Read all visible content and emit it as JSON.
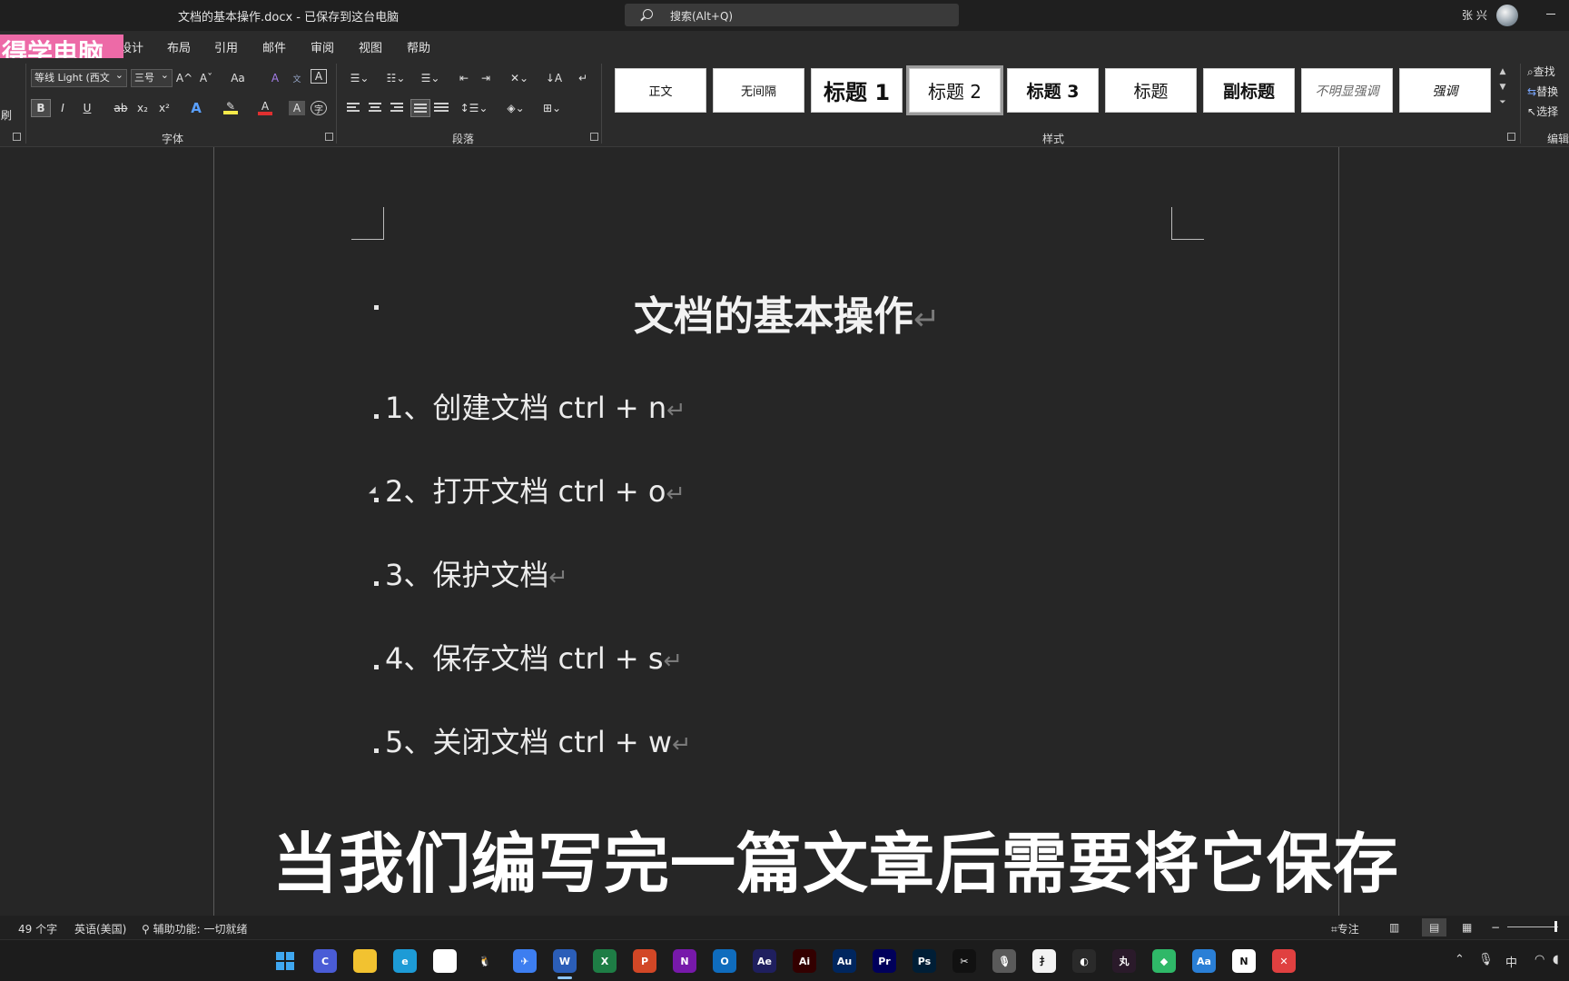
{
  "window": {
    "title": "文档的基本操作.docx  -  已保存到这台电脑",
    "search_placeholder": "搜索(Alt+Q)",
    "user": "张 兴"
  },
  "watermark": "得学电脑",
  "menu": {
    "tabs": [
      "设计",
      "布局",
      "引用",
      "邮件",
      "审阅",
      "视图",
      "帮助"
    ]
  },
  "ribbon": {
    "clipboard_partial": "刷",
    "font": {
      "name": "等线 Light (西文",
      "size": "三号",
      "label": "字体",
      "bold": "B",
      "italic": "I",
      "underline": "U",
      "strike": "ab",
      "subscript": "x₂",
      "superscript": "x²",
      "grow": "A^",
      "shrink": "Aˇ",
      "case": "Aa",
      "highlight_color": "#f5e94a",
      "font_color": "#e03030"
    },
    "paragraph": {
      "label": "段落"
    },
    "styles": {
      "label": "样式",
      "items": [
        "正文",
        "无间隔",
        "标题 1",
        "标题 2",
        "标题 3",
        "标题",
        "副标题",
        "不明显强调",
        "强调"
      ]
    },
    "editing": {
      "label": "编辑",
      "find": "查找",
      "replace": "替换",
      "select": "选择"
    }
  },
  "document": {
    "heading": "文档的基本操作",
    "items": [
      "1、创建文档  ctrl + n",
      "2、打开文档  ctrl + o",
      "3、保护文档",
      "4、保存文档  ctrl + s",
      "5、关闭文档  ctrl + w"
    ],
    "paragraph_mark": "↵"
  },
  "caption": "当我们编写完一篇文章后需要将它保存",
  "statusbar": {
    "word_count": "49 个字",
    "language": "英语(美国)",
    "accessibility": "辅助功能: 一切就绪",
    "focus": "专注"
  },
  "taskbar": {
    "icons": [
      {
        "name": "windows-start-icon",
        "color": "#3fa7f0",
        "text": ""
      },
      {
        "name": "browser-c-icon",
        "color": "#4a5cd6",
        "text": "C"
      },
      {
        "name": "file-explorer-icon",
        "color": "#f2c230",
        "text": ""
      },
      {
        "name": "edge-icon",
        "color": "#1d9bd6",
        "text": "e"
      },
      {
        "name": "photos-icon",
        "color": "#ffffff",
        "text": ""
      },
      {
        "name": "qq-icon",
        "color": "#1c1c1c",
        "text": "🐧"
      },
      {
        "name": "feishu-icon",
        "color": "#3d7ef0",
        "text": "✈"
      },
      {
        "name": "word-icon",
        "color": "#2b5eb8",
        "text": "W"
      },
      {
        "name": "excel-icon",
        "color": "#1e7d45",
        "text": "X"
      },
      {
        "name": "powerpoint-icon",
        "color": "#d24726",
        "text": "P"
      },
      {
        "name": "onenote-icon",
        "color": "#7719aa",
        "text": "N"
      },
      {
        "name": "outlook-icon",
        "color": "#0f6cbd",
        "text": "O"
      },
      {
        "name": "after-effects-icon",
        "color": "#1f1f5e",
        "text": "Ae"
      },
      {
        "name": "illustrator-icon",
        "color": "#330000",
        "text": "Ai"
      },
      {
        "name": "audition-icon",
        "color": "#00265e",
        "text": "Au"
      },
      {
        "name": "premiere-icon",
        "color": "#00005b",
        "text": "Pr"
      },
      {
        "name": "photoshop-icon",
        "color": "#001e36",
        "text": "Ps"
      },
      {
        "name": "capcut-icon",
        "color": "#111111",
        "text": "✂"
      },
      {
        "name": "microphone-app-icon",
        "color": "#5a5a5a",
        "text": "🎙"
      },
      {
        "name": "typora-icon",
        "color": "#f2f2f2",
        "text": "扌"
      },
      {
        "name": "obs-icon",
        "color": "#2a2a2a",
        "text": "◐"
      },
      {
        "name": "pink-app-icon",
        "color": "#2a1a2a",
        "text": "丸"
      },
      {
        "name": "green-app-icon",
        "color": "#2fb868",
        "text": "◆"
      },
      {
        "name": "text-app-icon",
        "color": "#2a7fd6",
        "text": "Aa"
      },
      {
        "name": "notion-icon",
        "color": "#ffffff",
        "text": "N"
      },
      {
        "name": "xmind-icon",
        "color": "#e04040",
        "text": "✕"
      }
    ],
    "tray": {
      "ime": "中"
    }
  }
}
